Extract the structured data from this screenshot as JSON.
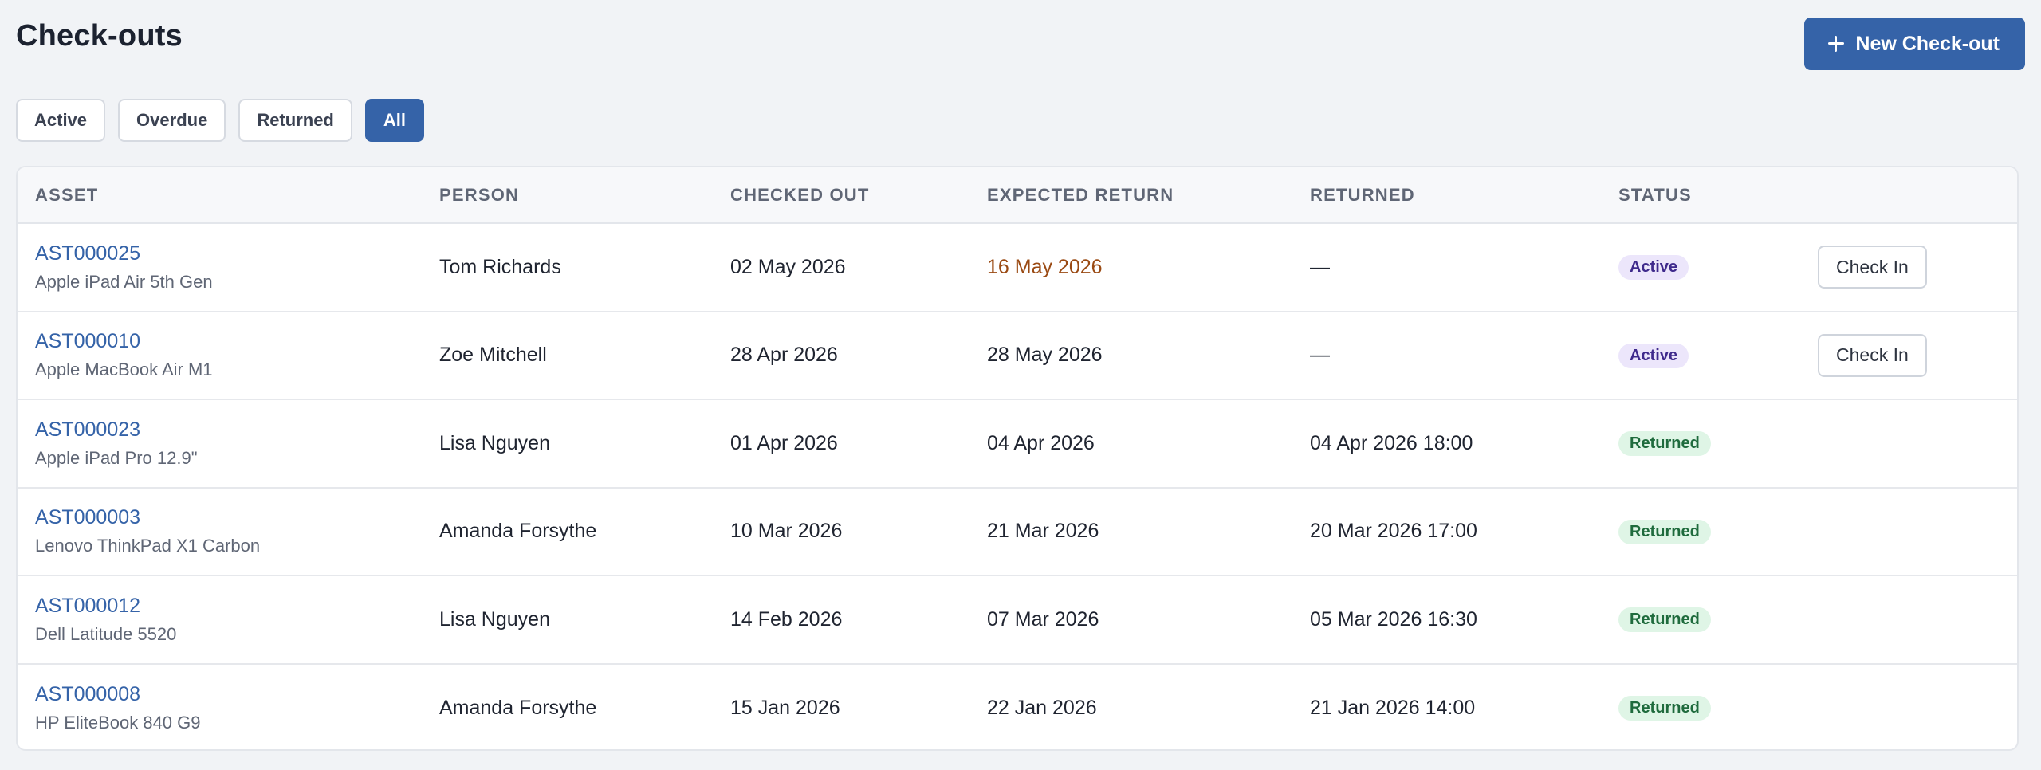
{
  "header": {
    "title": "Check-outs",
    "new_button_label": "New Check-out"
  },
  "filters": [
    {
      "label": "Active",
      "selected": false
    },
    {
      "label": "Overdue",
      "selected": false
    },
    {
      "label": "Returned",
      "selected": false
    },
    {
      "label": "All",
      "selected": true
    }
  ],
  "table": {
    "columns": [
      "ASSET",
      "PERSON",
      "CHECKED OUT",
      "EXPECTED RETURN",
      "RETURNED",
      "STATUS",
      ""
    ],
    "rows": [
      {
        "asset_id": "AST000025",
        "asset_name": "Apple iPad Air 5th Gen",
        "person": "Tom Richards",
        "checked_out": "02 May 2026",
        "expected_return": "16 May 2026",
        "expected_highlight": true,
        "returned": "—",
        "status": "Active",
        "action": "Check In"
      },
      {
        "asset_id": "AST000010",
        "asset_name": "Apple MacBook Air M1",
        "person": "Zoe Mitchell",
        "checked_out": "28 Apr 2026",
        "expected_return": "28 May 2026",
        "expected_highlight": false,
        "returned": "—",
        "status": "Active",
        "action": "Check In"
      },
      {
        "asset_id": "AST000023",
        "asset_name": "Apple iPad Pro 12.9\"",
        "person": "Lisa Nguyen",
        "checked_out": "01 Apr 2026",
        "expected_return": "04 Apr 2026",
        "expected_highlight": false,
        "returned": "04 Apr 2026 18:00",
        "status": "Returned",
        "action": ""
      },
      {
        "asset_id": "AST000003",
        "asset_name": "Lenovo ThinkPad X1 Carbon",
        "person": "Amanda Forsythe",
        "checked_out": "10 Mar 2026",
        "expected_return": "21 Mar 2026",
        "expected_highlight": false,
        "returned": "20 Mar 2026 17:00",
        "status": "Returned",
        "action": ""
      },
      {
        "asset_id": "AST000012",
        "asset_name": "Dell Latitude 5520",
        "person": "Lisa Nguyen",
        "checked_out": "14 Feb 2026",
        "expected_return": "07 Mar 2026",
        "expected_highlight": false,
        "returned": "05 Mar 2026 16:30",
        "status": "Returned",
        "action": ""
      },
      {
        "asset_id": "AST000008",
        "asset_name": "HP EliteBook 840 G9",
        "person": "Amanda Forsythe",
        "checked_out": "15 Jan 2026",
        "expected_return": "22 Jan 2026",
        "expected_highlight": false,
        "returned": "21 Jan 2026 14:00",
        "status": "Returned",
        "action": ""
      }
    ]
  },
  "colors": {
    "primary": "#3563a8",
    "overdue_text": "#9a4a13",
    "active_badge_bg": "#ece6fb",
    "returned_badge_bg": "#dff5e6"
  },
  "icons": {
    "new_button": "plus-icon"
  }
}
